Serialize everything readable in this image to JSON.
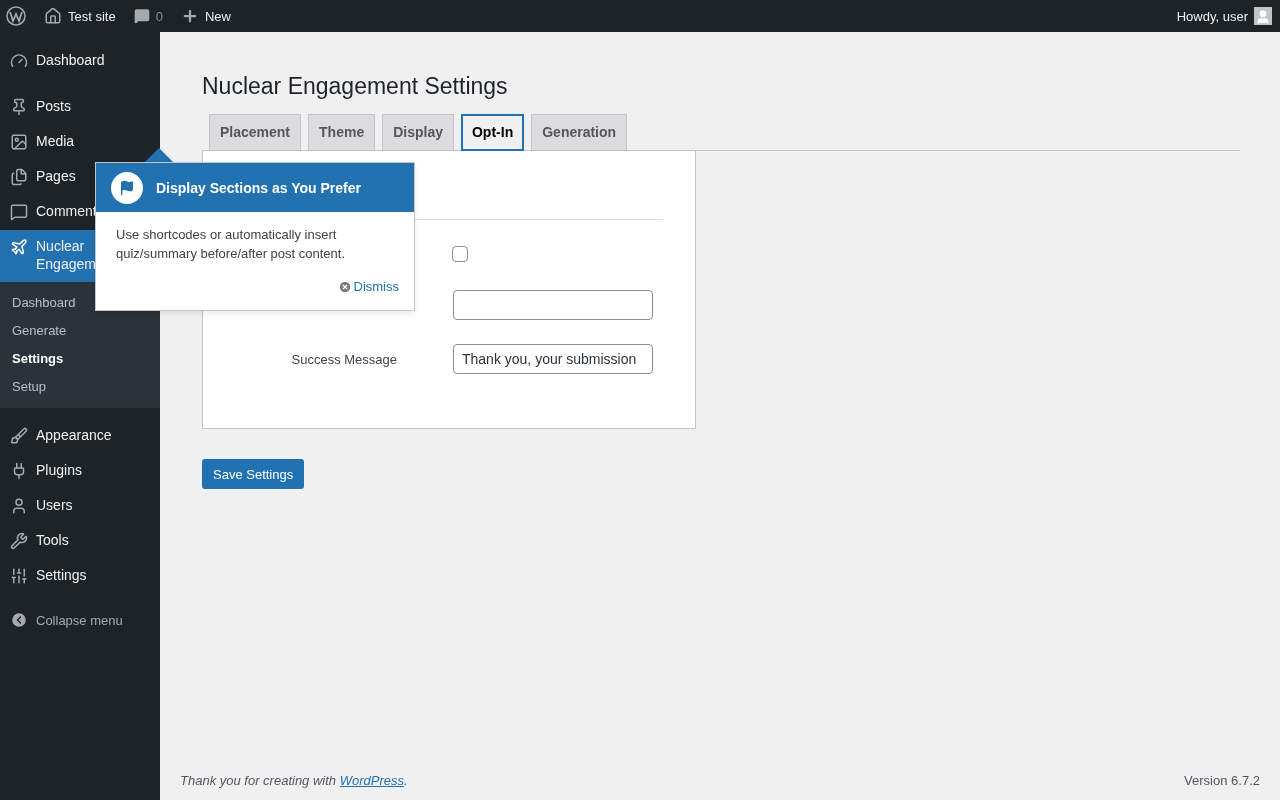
{
  "admin_bar": {
    "site": "Test site",
    "comments": "0",
    "new": "New",
    "greeting": "Howdy, user"
  },
  "menu_groups": [
    {
      "items": [
        {
          "label": "Dashboard",
          "selected": false
        }
      ]
    },
    {
      "items": [
        {
          "label": "Posts",
          "selected": false
        },
        {
          "label": "Media",
          "selected": false
        },
        {
          "label": "Pages",
          "selected": false
        },
        {
          "label": "Comment",
          "selected": false
        },
        {
          "label": "Nuclear Engagem",
          "selected": true,
          "submenu": [
            {
              "label": "Dashboard",
              "selected": false
            },
            {
              "label": "Generate",
              "selected": false
            },
            {
              "label": "Settings",
              "selected": true
            },
            {
              "label": "Setup",
              "selected": false
            }
          ]
        }
      ]
    },
    {
      "items": [
        {
          "label": "Appearance",
          "selected": false
        },
        {
          "label": "Plugins",
          "selected": false
        },
        {
          "label": "Users",
          "selected": false
        },
        {
          "label": "Tools",
          "selected": false
        },
        {
          "label": "Settings",
          "selected": false
        }
      ]
    }
  ],
  "collapse": "Collapse menu",
  "page_title": "Nuclear Engagement Settings",
  "tabs": [
    {
      "label": "Placement",
      "selected": false
    },
    {
      "label": "Theme",
      "selected": false
    },
    {
      "label": "Display",
      "selected": false
    },
    {
      "label": "Opt-In",
      "selected": true
    },
    {
      "label": "Generation",
      "selected": false
    }
  ],
  "form_rows": [
    {
      "kind": "checkbox",
      "checked": false
    },
    {
      "kind": "text"
    },
    {
      "kind": "text",
      "label": "Success Message",
      "value": "Thank you, your submission"
    }
  ],
  "save_button": "Save Settings",
  "pointer": {
    "title": "Display Sections as You Prefer",
    "body": "Use shortcodes or automatically insert quiz/summary before/after post content.",
    "dismiss": "Dismiss"
  },
  "footer": {
    "before": "Thank you for creating with ",
    "link": "WordPress",
    "after": ".",
    "version": "Version 6.7.2"
  }
}
